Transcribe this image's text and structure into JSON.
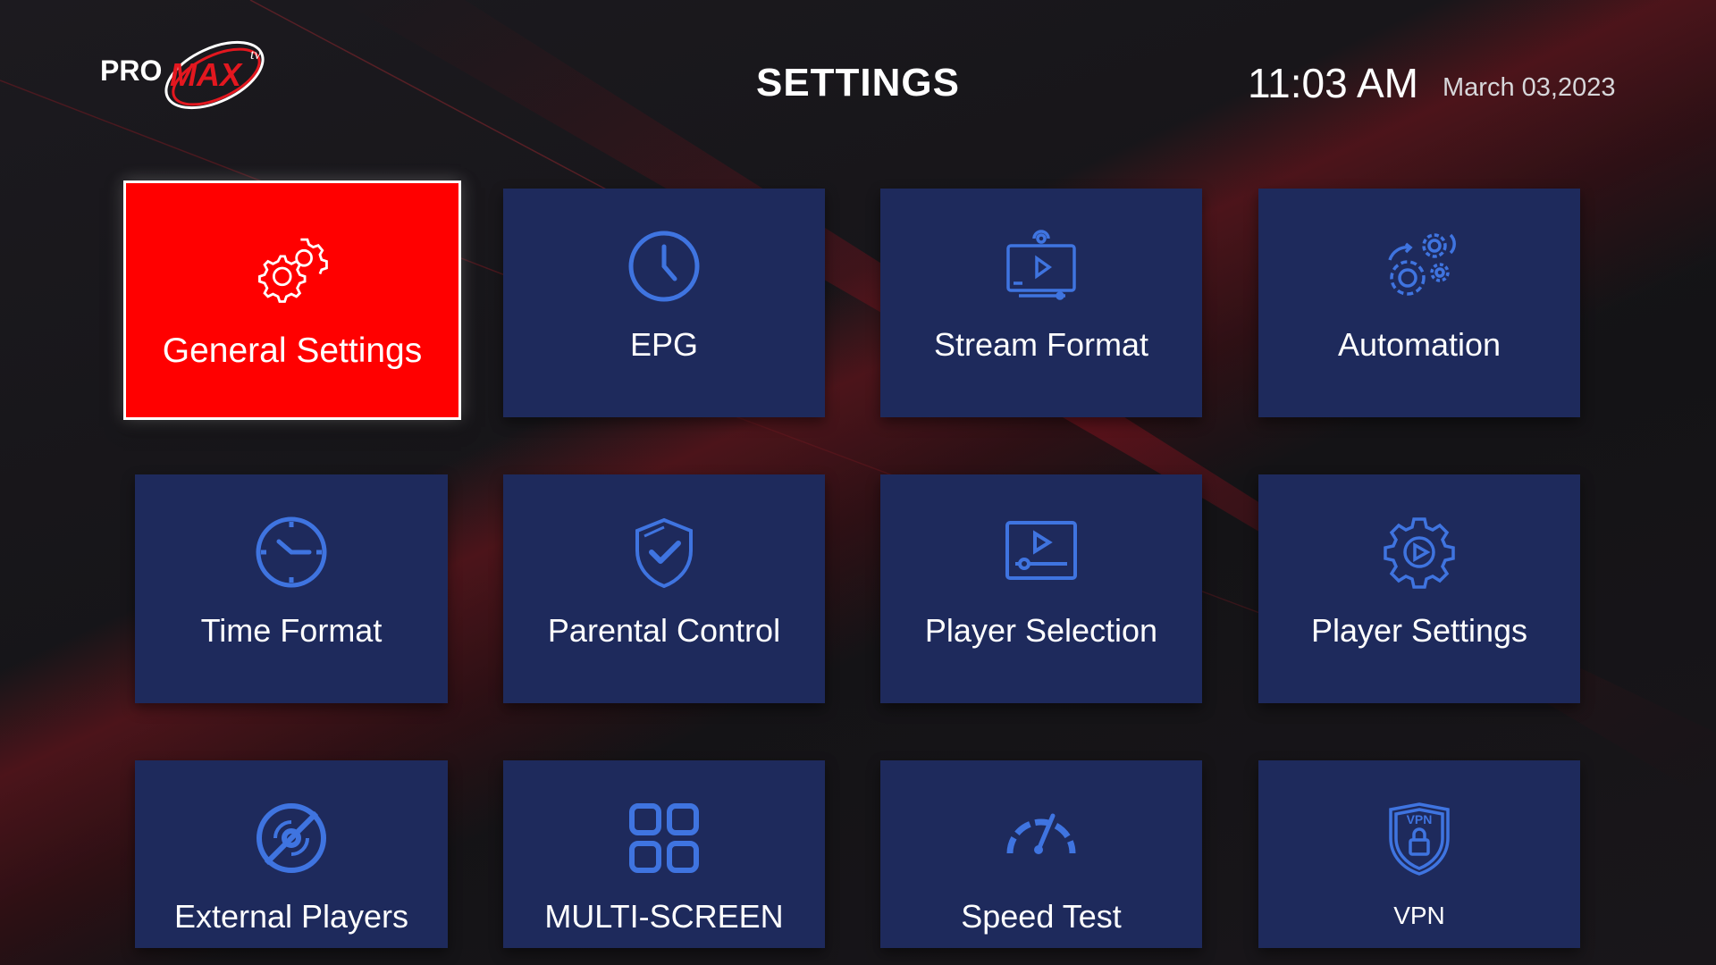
{
  "header": {
    "logo_text": "PROMAX",
    "logo_badge": "tv",
    "title": "SETTINGS",
    "time": "11:03 AM",
    "date": "March 03,2023"
  },
  "colors": {
    "tile": "#1e2a5c",
    "tile_active": "#ff0000",
    "icon": "#3f74e0",
    "icon_active": "#ffffff",
    "brand_red": "#e3171f"
  },
  "tiles": [
    {
      "label": "General Settings",
      "icon": "gears-icon",
      "selected": true
    },
    {
      "label": "EPG",
      "icon": "clock-icon",
      "selected": false
    },
    {
      "label": "Stream Format",
      "icon": "stream-monitor-icon",
      "selected": false
    },
    {
      "label": "Automation",
      "icon": "automation-gears-icon",
      "selected": false
    },
    {
      "label": "Time Format",
      "icon": "time-clock-icon",
      "selected": false
    },
    {
      "label": "Parental Control",
      "icon": "shield-check-icon",
      "selected": false
    },
    {
      "label": "Player Selection",
      "icon": "player-screen-icon",
      "selected": false
    },
    {
      "label": "Player Settings",
      "icon": "gear-play-icon",
      "selected": false
    },
    {
      "label": "External Players",
      "icon": "disc-off-icon",
      "selected": false
    },
    {
      "label": "MULTI-SCREEN",
      "icon": "grid-icon",
      "selected": false
    },
    {
      "label": "Speed Test",
      "icon": "speedometer-icon",
      "selected": false
    },
    {
      "label": "VPN",
      "icon": "vpn-shield-icon",
      "selected": false
    }
  ]
}
